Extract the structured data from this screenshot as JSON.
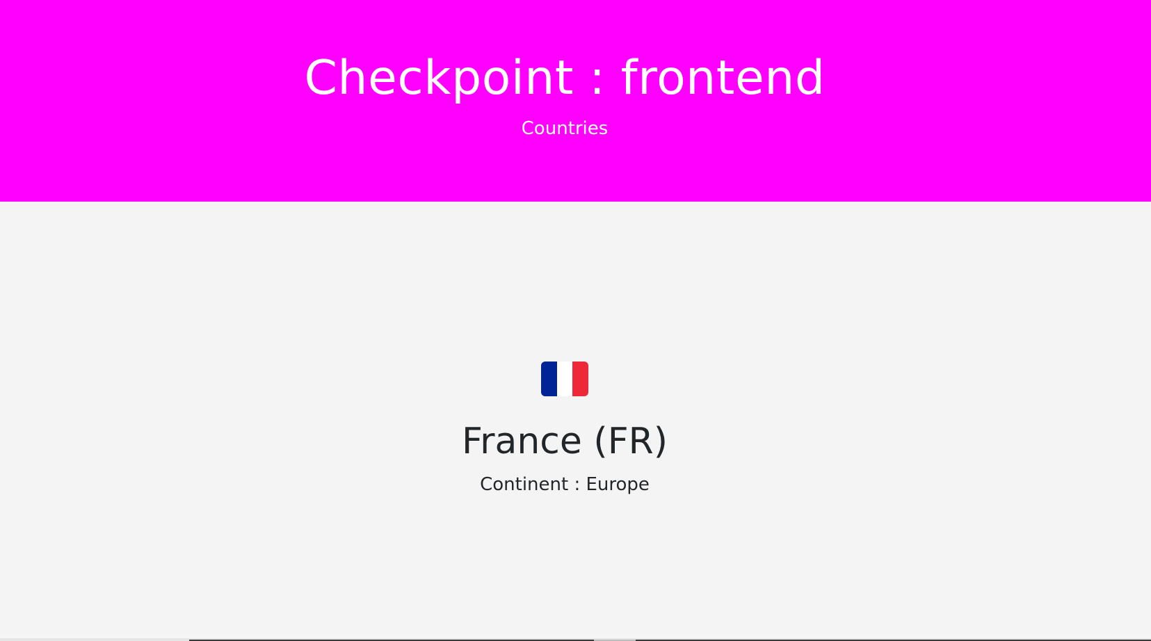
{
  "header": {
    "title": "Checkpoint : frontend",
    "subtitle": "Countries",
    "background_color": "#ff00ff",
    "text_color": "#ffffff"
  },
  "country": {
    "flag_icon": "flag-france-icon",
    "flag_colors": [
      "#002395",
      "#ffffff",
      "#ed2939"
    ],
    "name": "France (FR)",
    "continent": "Continent : Europe"
  }
}
